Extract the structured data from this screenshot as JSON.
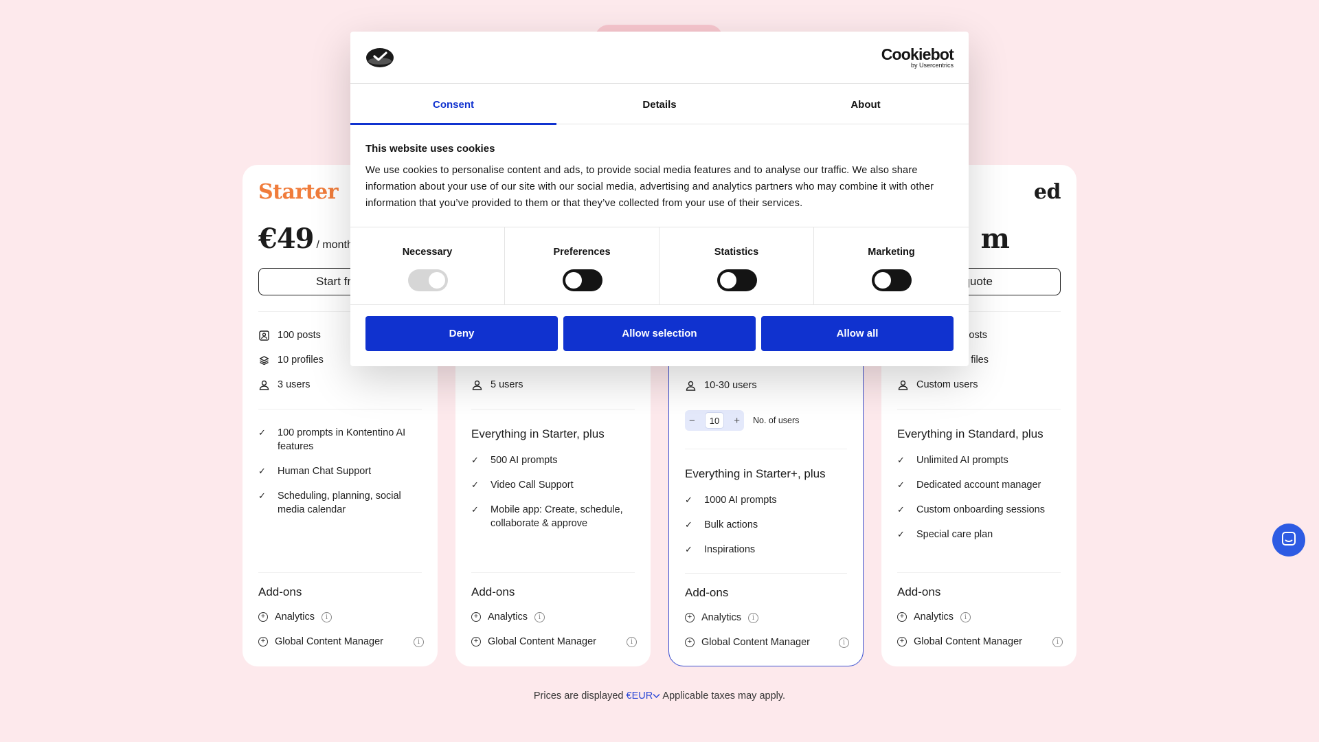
{
  "pricing": {
    "plans": [
      {
        "name": "Starter",
        "price": "€49",
        "period": "/ month",
        "button": "Start free",
        "quotas": [
          "100 posts",
          "10 profiles",
          "3 users"
        ],
        "intro": "",
        "features": [
          "100 prompts in Kontentino AI features",
          "Human Chat Support",
          "Scheduling, planning, social media calendar"
        ]
      },
      {
        "users": "5 users",
        "intro": "Everything in Starter, plus",
        "features": [
          "500 AI prompts",
          "Video Call Support",
          "Mobile app: Create, schedule, collaborate & approve"
        ]
      },
      {
        "users": "10-30 users",
        "stepper_value": "10",
        "stepper_label": "No. of users",
        "intro": "Everything in Starter+, plus",
        "features": [
          "1000 AI prompts",
          "Bulk actions",
          "Inspirations"
        ]
      },
      {
        "name_partial": "ed",
        "price_partial": "m",
        "button_partial": "est quote",
        "quotas_partial": [
          "osts",
          "files"
        ],
        "users": "Custom users",
        "intro": "Everything in Standard, plus",
        "features": [
          "Unlimited AI prompts",
          "Dedicated account manager",
          "Custom onboarding sessions",
          "Special care plan"
        ]
      }
    ],
    "addons_title": "Add-ons",
    "addons": [
      "Analytics",
      "Global Content Manager"
    ],
    "info_glyph": "i",
    "footer": {
      "prefix": "Prices are displayed",
      "currency": "€EUR",
      "suffix": "Applicable taxes may apply."
    }
  },
  "cookie_dialog": {
    "brand": "Cookiebot",
    "brand_sub": "by Usercentrics",
    "tabs": [
      "Consent",
      "Details",
      "About"
    ],
    "title": "This website uses cookies",
    "body": "We use cookies to personalise content and ads, to provide social media features and to analyse our traffic. We also share information about your use of our site with our social media, advertising and analytics partners who may combine it with other information that you’ve provided to them or that they’ve collected from your use of their services.",
    "categories": [
      {
        "label": "Necessary",
        "on": true,
        "disabled": true
      },
      {
        "label": "Preferences",
        "on": false
      },
      {
        "label": "Statistics",
        "on": false
      },
      {
        "label": "Marketing",
        "on": false
      }
    ],
    "buttons": [
      "Deny",
      "Allow selection",
      "Allow all"
    ],
    "accent": "#1032cf"
  },
  "colors": {
    "background": "#fde9ec",
    "starter_title": "#f07c3b",
    "highlight_border": "#3a4fd0",
    "chat_button": "#2d5be3"
  },
  "icons": [
    "post-icon",
    "profiles-icon",
    "user-icon",
    "check-icon",
    "plus-circle-icon",
    "info-icon",
    "chevron-down-icon",
    "chat-icon",
    "cookie-logo-icon"
  ]
}
